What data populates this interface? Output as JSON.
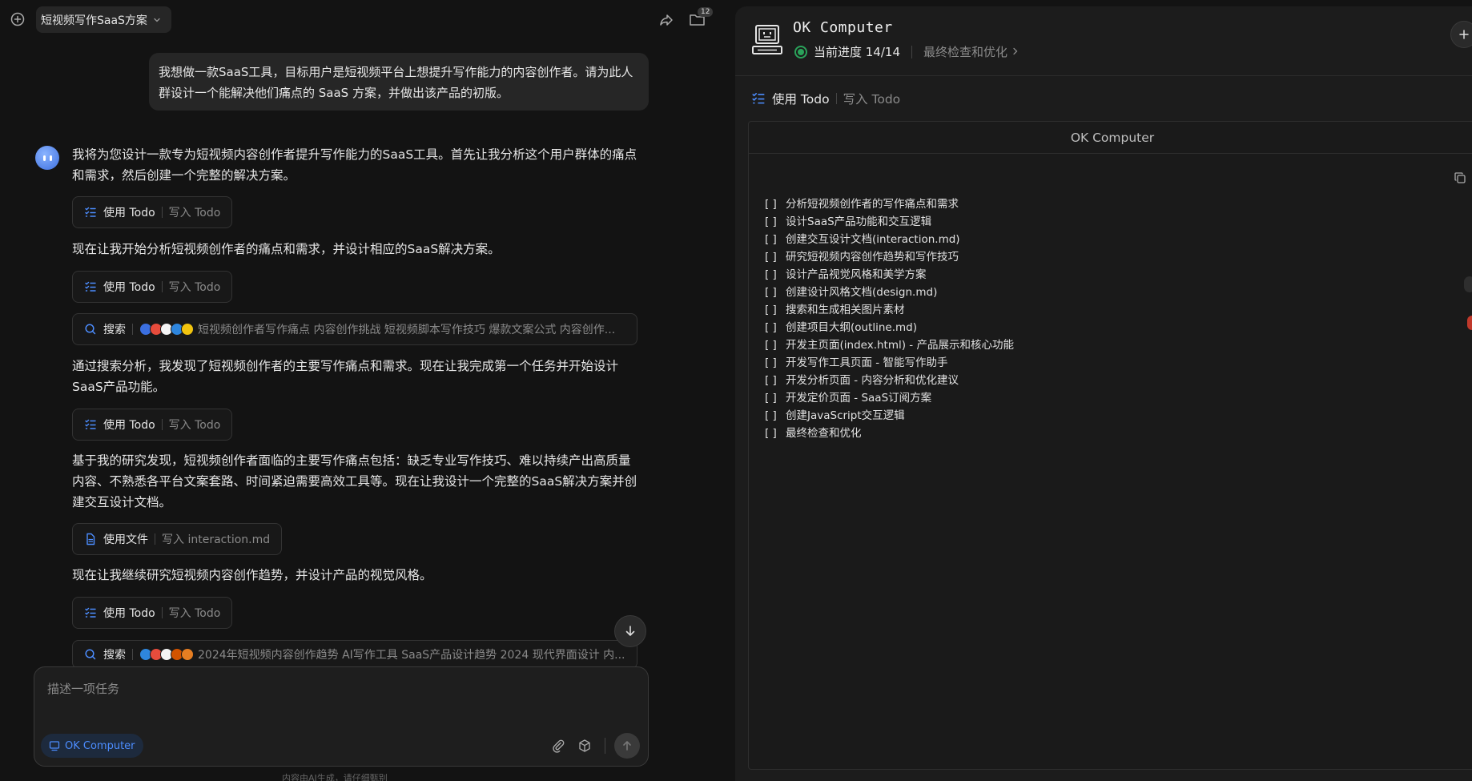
{
  "topbar": {
    "conversation_title": "短视频写作SaaS方案",
    "folder_count": "12"
  },
  "user_message": "我想做一款SaaS工具，目标用户是短视频平台上想提升写作能力的内容创作者。请为此人群设计一个能解决他们痛点的 SaaS 方案，并做出该产品的初版。",
  "assistant": {
    "msg1": "我将为您设计一款专为短视频内容创作者提升写作能力的SaaS工具。首先让我分析这个用户群体的痛点和需求，然后创建一个完整的解决方案。",
    "msg2": "现在让我开始分析短视频创作者的痛点和需求，并设计相应的SaaS解决方案。",
    "msg3": "通过搜索分析，我发现了短视频创作者的主要写作痛点和需求。现在让我完成第一个任务并开始设计SaaS产品功能。",
    "msg4": "基于我的研究发现，短视频创作者面临的主要写作痛点包括：缺乏专业写作技巧、难以持续产出高质量内容、不熟悉各平台文案套路、时间紧迫需要高效工具等。现在让我设计一个完整的SaaS解决方案并创建交互设计文档。",
    "msg5": "现在让我继续研究短视频内容创作趋势，并设计产品的视觉风格。"
  },
  "tools": {
    "todo_label": "使用 Todo",
    "todo_action": "写入 Todo",
    "search_label": "搜索",
    "search1_query": "短视频创作者写作痛点 内容创作挑战 短视频脚本写作技巧 爆款文案公式 内容创作...",
    "search2_query": "2024年短视频内容创作趋势 AI写作工具 SaaS产品设计趋势 2024 现代界面设计 内...",
    "file_label": "使用文件",
    "file_action": "写入 interaction.md"
  },
  "composer": {
    "placeholder": "描述一项任务",
    "mode_label": "OK Computer"
  },
  "disclaimer": "内容由AI生成，请仔细甄别",
  "panel": {
    "title": "OK Computer",
    "progress": "当前进度 14/14",
    "current_step": "最终检查和优化",
    "todo_label": "使用 Todo",
    "todo_action": "写入 Todo",
    "viewer_title": "OK Computer",
    "todos": [
      "分析短视频创作者的写作痛点和需求",
      "设计SaaS产品功能和交互逻辑",
      "创建交互设计文档(interaction.md)",
      "研究短视频内容创作趋势和写作技巧",
      "设计产品视觉风格和美学方案",
      "创建设计风格文档(design.md)",
      "搜索和生成相关图片素材",
      "创建项目大纲(outline.md)",
      "开发主页面(index.html) - 产品展示和核心功能",
      "开发写作工具页面 - 智能写作助手",
      "开发分析页面 - 内容分析和优化建议",
      "开发定价页面 - SaaS订阅方案",
      "创建JavaScript交互逻辑",
      "最终检查和优化"
    ],
    "checkbox": "[    ]"
  },
  "colors": {
    "accent": "#4c8dff",
    "success": "#2aa35a",
    "background": "#131313",
    "panel": "#1c1c1c"
  },
  "icons": {
    "new_chat": "new-chat-icon",
    "share": "share-icon",
    "folder": "folder-icon",
    "todo": "checklist-icon",
    "search": "search-icon",
    "file": "file-icon",
    "attach": "paperclip-icon",
    "cube": "cube-icon",
    "send": "arrow-up-icon",
    "scroll": "arrow-down-icon",
    "copy": "copy-icon",
    "computer": "computer-icon"
  }
}
